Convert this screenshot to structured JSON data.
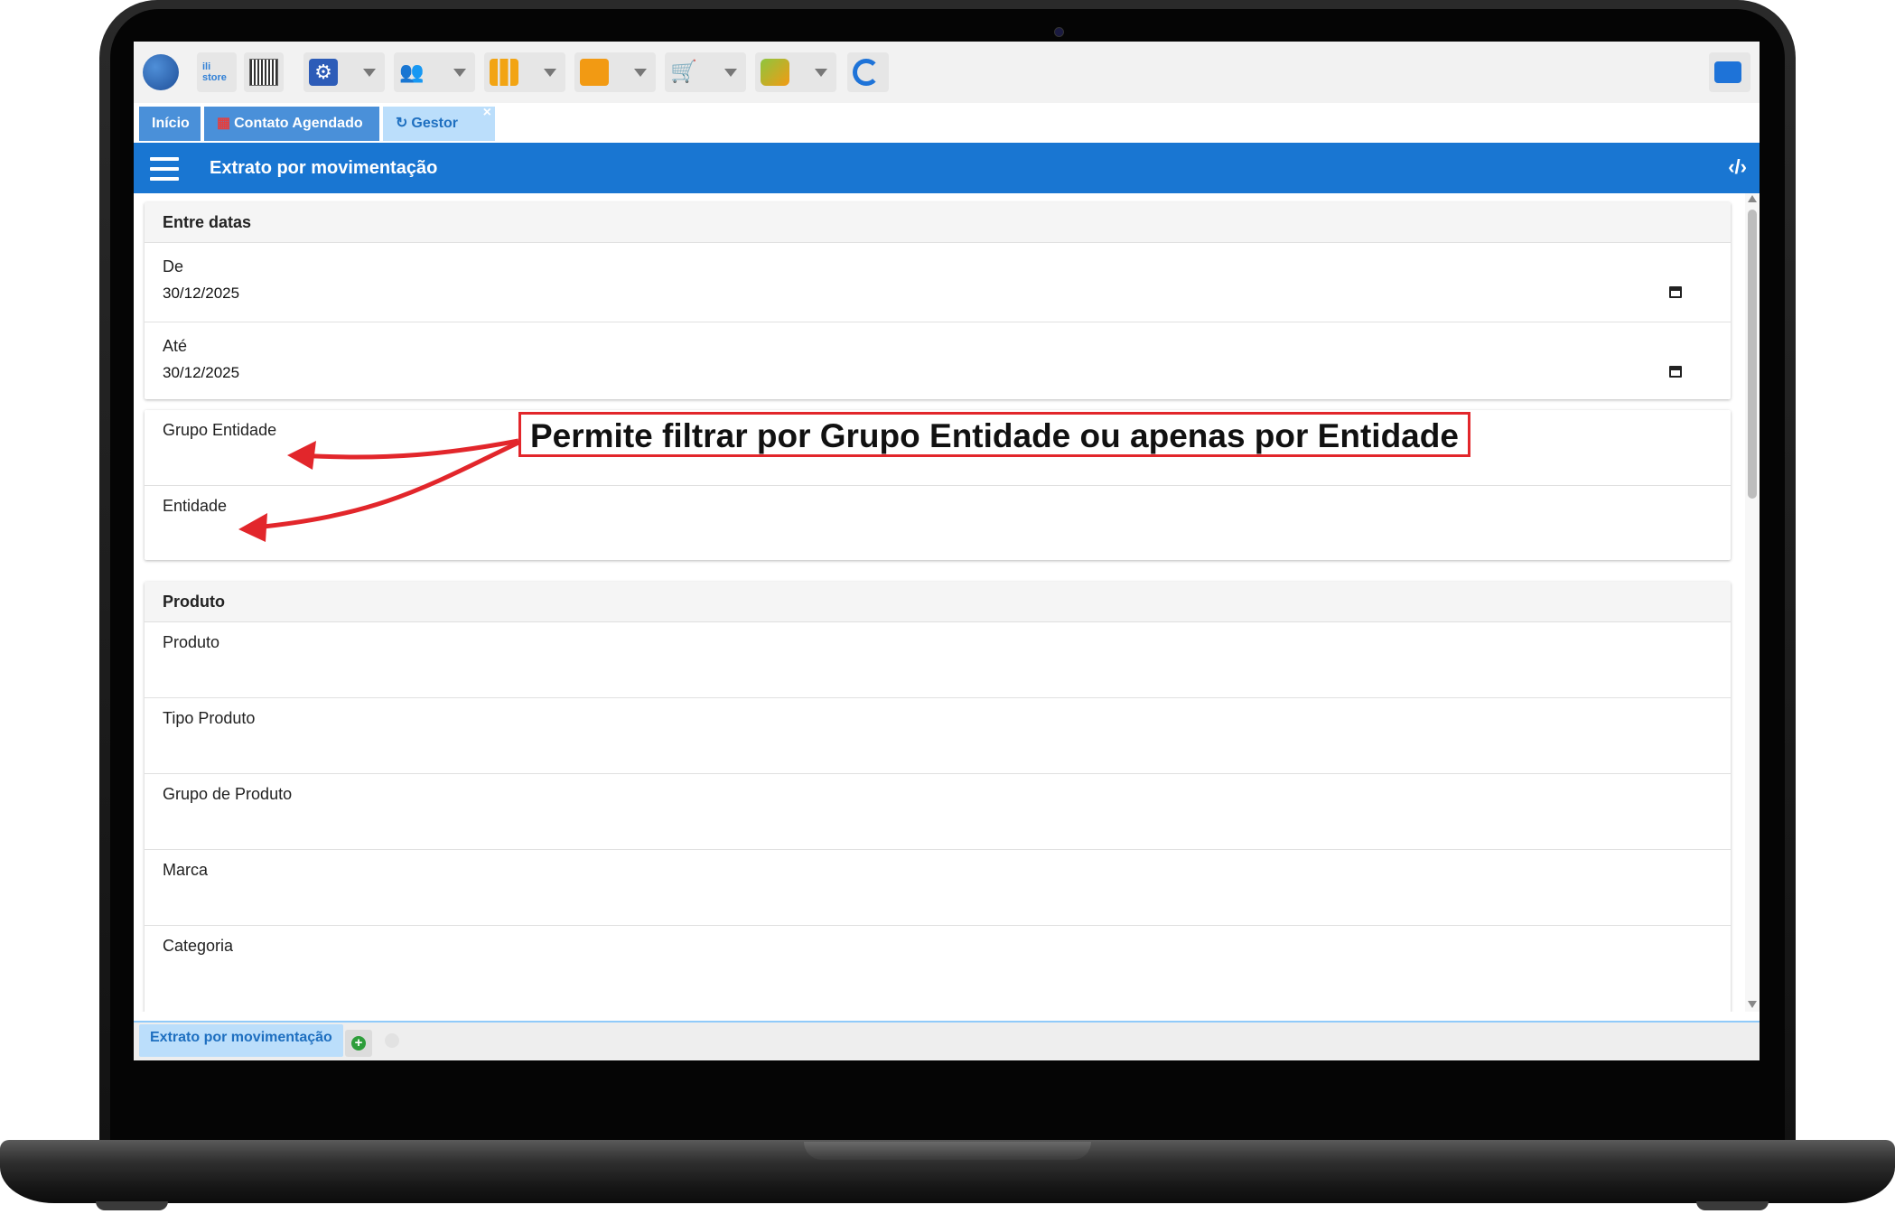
{
  "tabs": [
    {
      "label": "Início",
      "color": "#4a90d9"
    },
    {
      "label": "Contato Agendado",
      "color": "#4a90d9"
    },
    {
      "label": "Gestor",
      "color": "#bbdefb",
      "close": "×"
    }
  ],
  "header": {
    "title": "Extrato por movimentação",
    "menu_icon": "hamburger-menu-icon",
    "code_icon": "code-icon"
  },
  "sections": {
    "entre_datas": {
      "title": "Entre datas",
      "de_label": "De",
      "de_value": "30/12/2025",
      "ate_label": "Até",
      "ate_value": "30/12/2025"
    },
    "entidade": {
      "grupo_label": "Grupo Entidade",
      "entidade_label": "Entidade"
    },
    "produto": {
      "title": "Produto",
      "fields": [
        "Produto",
        "Tipo Produto",
        "Grupo de Produto",
        "Marca",
        "Categoria"
      ]
    }
  },
  "bottom_tab": {
    "label": "Extrato por movimentação"
  },
  "annotation": {
    "text": "Permite filtrar por Grupo Entidade ou apenas por Entidade",
    "color": "#e2262b"
  },
  "colors": {
    "header": "#1976d2",
    "toolbar": "#f2f2f2"
  }
}
